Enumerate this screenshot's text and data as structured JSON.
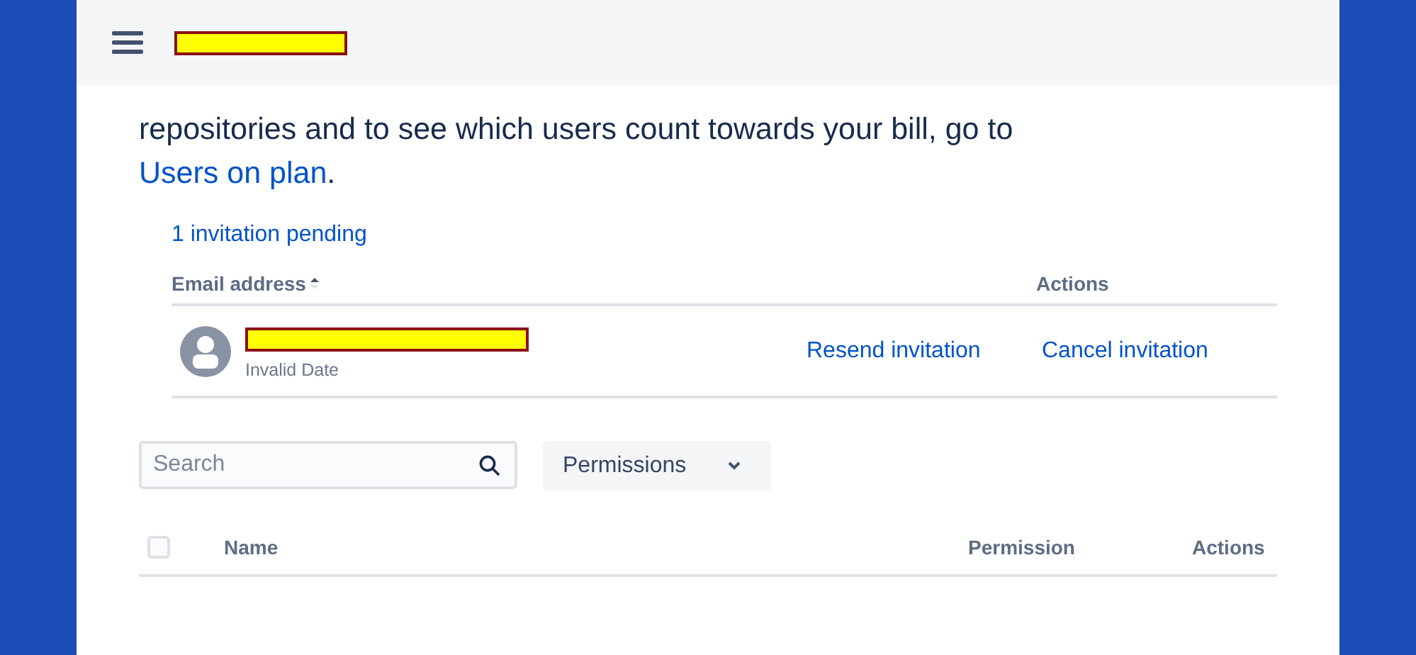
{
  "header": {
    "title_redacted": true
  },
  "intro": {
    "text": "repositories and to see which users count towards your bill, go to ",
    "link": "Users on plan",
    "end": "."
  },
  "invitations": {
    "summary": "1 invitation pending",
    "columns": [
      {
        "label": "Email address",
        "sorted": true
      },
      {
        "label": "Actions",
        "sorted": false
      }
    ],
    "rows": [
      {
        "email_redacted": true,
        "date": "Invalid Date",
        "actions": [
          "Resend invitation",
          "Cancel invitation"
        ]
      }
    ]
  },
  "search": {
    "placeholder": "Search"
  },
  "filter": {
    "label": "Permissions"
  },
  "members": {
    "select_all_checked": false,
    "columns": [
      "Name",
      "Permission",
      "Actions"
    ]
  }
}
